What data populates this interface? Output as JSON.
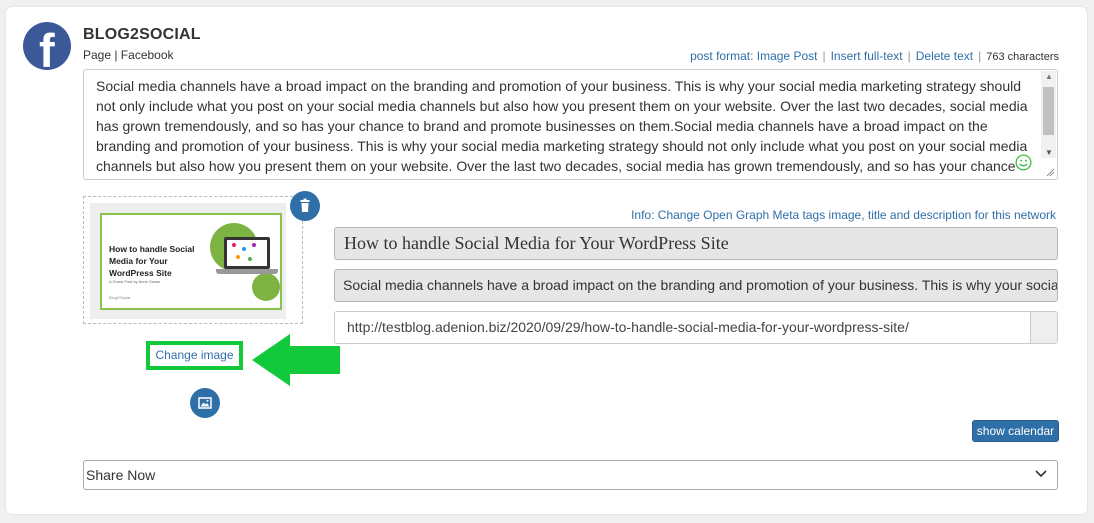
{
  "account": {
    "name": "BLOG2SOCIAL",
    "type": "Page | Facebook",
    "network_icon": "facebook-icon",
    "brand_color": "#3b5998"
  },
  "toolbar": {
    "post_format": "post format: Image Post",
    "insert_full_text": "Insert full-text",
    "delete_text": "Delete text",
    "separator": "|",
    "char_count": "763 characters"
  },
  "post_text": "Social media channels have a broad impact on the branding and promotion of your business. This is why your social media marketing strategy should not only include what you post on your social media channels but also how you present them on your website. Over the last two decades, social media has grown tremendously, and so has your chance to brand and promote businesses on them.Social media channels have a broad impact on the branding and promotion of your business. This is why your social media marketing strategy should not only include what you post on your social media channels but also how you present them on your website. Over the last two decades, social media has grown tremendously, and so has your chance to brand and promote businesses on them.",
  "image": {
    "thumb_title": "How to handle Social Media for Your WordPress Site",
    "thumb_subtitle": "A Guest Post by Anne Susan",
    "thumb_logo": "Blog2Social",
    "change_label": "Change image",
    "delete_icon": "trash-icon",
    "media_icon": "image-icon",
    "highlight_color": "#11c93a"
  },
  "og": {
    "info": "Info: Change Open Graph Meta tags image, title and description for this network",
    "title": "How to handle Social Media for Your WordPress Site",
    "description": "Social media channels have a broad impact on the branding and promotion of your business. This is why your social media marketing strategy",
    "url": "http://testblog.adenion.biz/2020/09/29/how-to-handle-social-media-for-your-wordpress-site/"
  },
  "calendar_button": "show calendar",
  "share": {
    "selected": "Share Now"
  },
  "colors": {
    "accent": "#2f6fa8",
    "green": "#11c93a"
  }
}
